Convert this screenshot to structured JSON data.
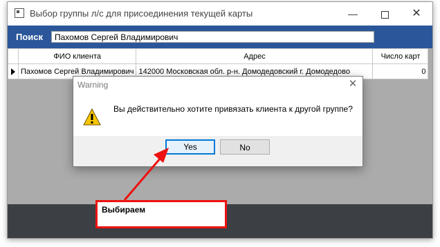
{
  "window": {
    "title": "Выбор группы л/с для присоединения текущей карты",
    "minimize": "—",
    "close": "✕"
  },
  "search": {
    "label": "Поиск",
    "value": "Пахомов Сергей Владимирович"
  },
  "table": {
    "columns": [
      "ФИО клиента",
      "Адрес",
      "Число карт"
    ],
    "rows": [
      [
        "Пахомов Сергей Владимирович",
        "142000 Московская обл. р-н. Домодедовский г. Домодедово",
        "0"
      ]
    ]
  },
  "dialog": {
    "title": "Warning",
    "close": "✕",
    "message": "Вы действительно хотите привязать клиента к другой группе?",
    "yes": "Yes",
    "no": "No",
    "icon": "warning-icon"
  },
  "annotation": {
    "text": "Выбираем",
    "color": "#ee1111"
  },
  "colors": {
    "accent": "#2b579a",
    "footer": "#3c3f44",
    "focus": "#0078d7"
  }
}
